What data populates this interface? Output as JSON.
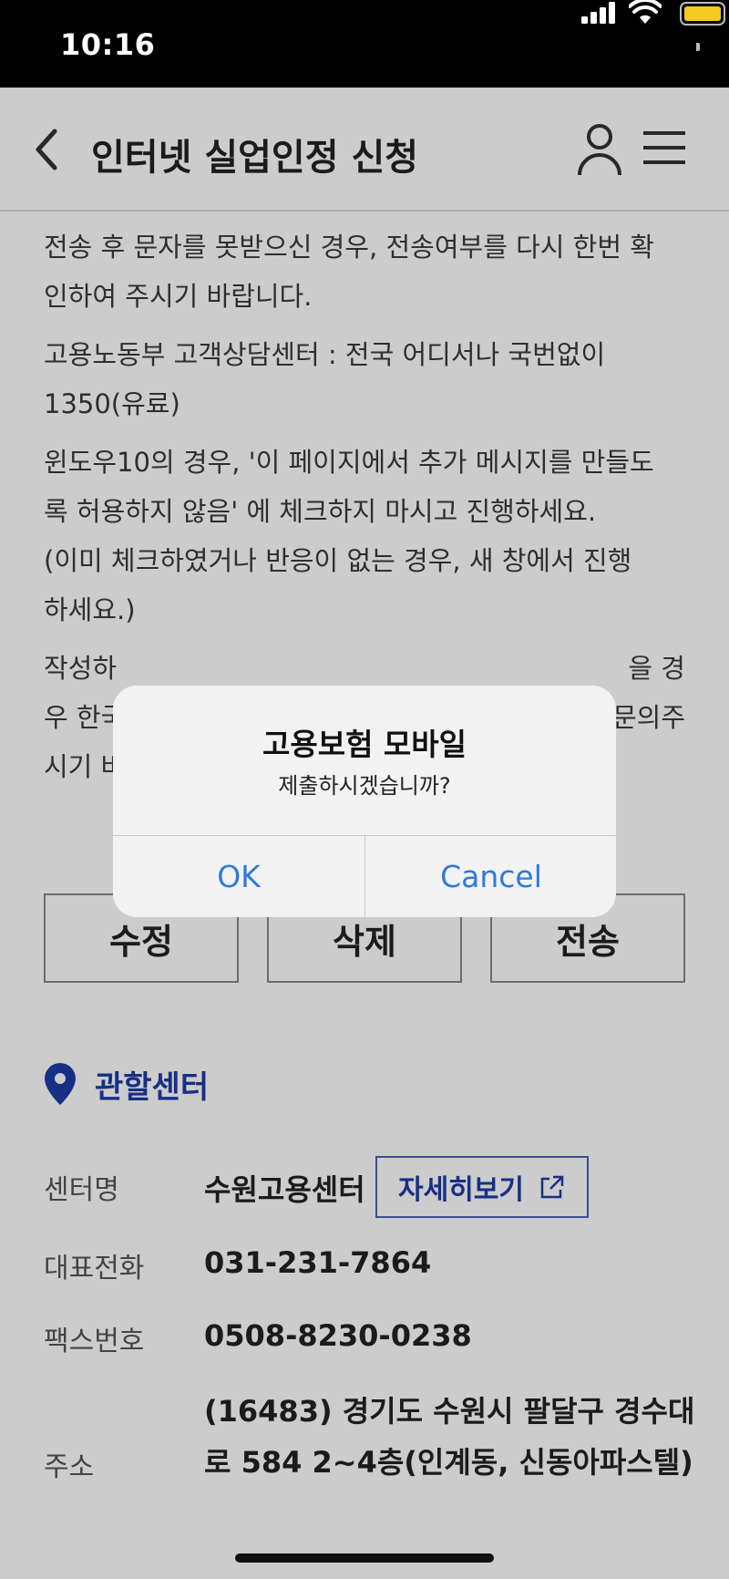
{
  "status_bar": {
    "time": "10:16"
  },
  "header": {
    "title": "인터넷 실업인정 신청"
  },
  "content": {
    "paragraphs": [
      [
        "전송 후 문자를 못받으신 경우, 전송여부를 다시 한번 확",
        "인하여 주시기 바랍니다."
      ],
      [
        "고용노동부 고객상담센터 : 전국 어디서나 국번없이",
        "1350(유료)"
      ],
      [
        "윈도우10의 경우, '이 페이지에서 추가 메시지를 만들도",
        "록 허용하지 않음' 에 체크하지 마시고 진행하세요.",
        "(이미 체크하였거나 반응이 없는 경우, 새 창에서 진행",
        "하세요.)"
      ],
      [
        "작성하",
        "우 한국",
        "시기 바"
      ]
    ],
    "partial_right": [
      "을 경",
      "문의주"
    ]
  },
  "actions": {
    "edit": "수정",
    "delete": "삭제",
    "send": "전송"
  },
  "center": {
    "section_title": "관할센터",
    "name_label": "센터명",
    "name_value": "수원고용센터",
    "detail_button": "자세히보기",
    "phone_label": "대표전화",
    "phone_value": "031-231-7864",
    "fax_label": "팩스번호",
    "fax_value": "0508-8230-0238",
    "address_label": "주소",
    "address_value": "(16483) 경기도 수원시 팔달구 경수대로 584 2~4층(인계동, 신동아파스텔)"
  },
  "alert": {
    "title": "고용보험 모바일",
    "message": "제출하시겠습니까?",
    "ok": "OK",
    "cancel": "Cancel"
  },
  "colors": {
    "accent": "#1e3ba8",
    "ios_blue": "#2f7ad9",
    "battery": "#f6c923"
  },
  "icons": [
    "back-chevron-icon",
    "user-icon",
    "menu-icon",
    "location-pin-icon",
    "external-link-icon"
  ]
}
